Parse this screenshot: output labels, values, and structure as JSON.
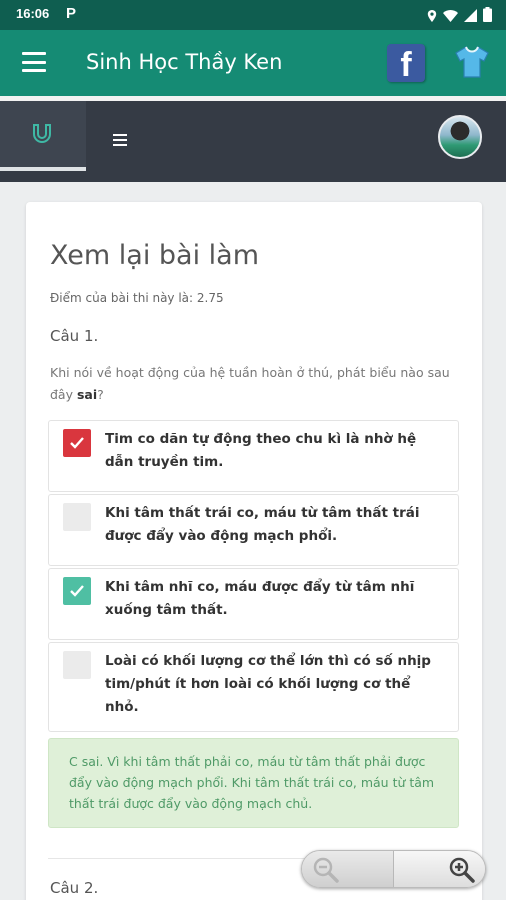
{
  "status_bar": {
    "time": "16:06",
    "app_icon": "P"
  },
  "app_bar": {
    "title": "Sinh Học Thầy Ken",
    "facebook_label": "f"
  },
  "review": {
    "heading": "Xem lại bài làm",
    "score_text": "Điểm của bài thi này là: 2.75",
    "question_1_label": "Câu 1.",
    "question_text_before": "Khi nói về hoạt động của hệ tuần hoàn ở thú, phát biểu nào sau đây ",
    "question_text_bold": "sai",
    "question_text_after": "?",
    "options": [
      {
        "text": "Tim co dãn tự động theo chu kì là nhờ hệ dẫn truyền tim.",
        "state": "wrong-selected"
      },
      {
        "text": "Khi tâm thất trái co, máu từ tâm thất trái được đẩy vào động mạch phổi.",
        "state": "unselected"
      },
      {
        "text": "Khi tâm nhĩ co, máu được đẩy từ tâm nhĩ xuống tâm thất.",
        "state": "correct"
      },
      {
        "text": "Loài có khối lượng cơ thể lớn thì có số nhịp tim/phút ít hơn loài có khối lượng cơ thể nhỏ.",
        "state": "unselected"
      }
    ],
    "explanation": "C sai. Vì khi tâm thất phải co, máu từ tâm thất phải được đẩy vào động mạch phổi. Khi tâm thất trái co, máu từ tâm thất trái được đẩy vào động mạch chủ.",
    "question_2_label": "Câu 2."
  },
  "icons": {
    "menu": "hamburger-menu-icon",
    "facebook": "facebook-icon",
    "shirt": "shirt-icon",
    "brand": "magnet-u-icon",
    "list": "list-icon",
    "zoom_out": "zoom-out-icon",
    "zoom_in": "zoom-in-icon"
  },
  "colors": {
    "status_bar": "#0f5e50",
    "app_bar": "#158b74",
    "toolbar": "#353b45",
    "wrong": "#d9363e",
    "correct": "#4fbfa3",
    "explanation_bg": "#dff0d8",
    "explanation_text": "#4f9a67"
  }
}
